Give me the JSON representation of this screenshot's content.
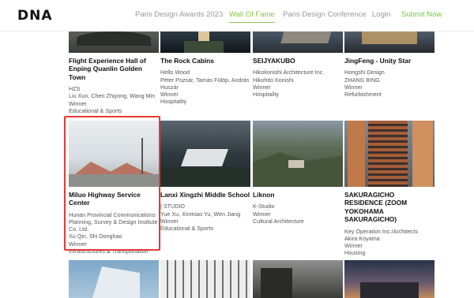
{
  "logo": "DNA",
  "nav": {
    "awards": "Paris Design Awards 2023",
    "wall": "Wall Of Fame",
    "conference": "Paris Design Conference",
    "login": "Login",
    "submit": "Submit Now"
  },
  "entries": [
    {
      "title": "Flight Experience Hall of Enping Quanlin Golden Town",
      "designer": [
        "HZS",
        "Liu Xun, Chen Zhiyong, Wang Min"
      ],
      "award": "Winner",
      "category": "Educational & Sports"
    },
    {
      "title": "The Rock Cabins",
      "designer": [
        "Hello Wood",
        "Péter Pozsár, Tamás Fülöp, András Huszár"
      ],
      "award": "Winner",
      "category": "Hospitality"
    },
    {
      "title": "SEIJYAKUBO",
      "designer": [
        "Hikokonishi Architecture Inc.",
        "Hikohito Konishi"
      ],
      "award": "Winner",
      "category": "Hospitality"
    },
    {
      "title": "JingFeng - Unity Star",
      "designer": [
        "Hongshi Design",
        "ZHANG BING"
      ],
      "award": "Winner",
      "category": "Refurbishment"
    },
    {
      "title": "Miluo Highway Service Center",
      "designer": [
        "Hunan Provincial Communications Planning, Survey & Design Institute Co. Ltd.",
        "Xu Qin, Shi Donghao"
      ],
      "award": "Winner",
      "category": "Infrastructures & Transportation"
    },
    {
      "title": "Lanxi Xingzhi Middle School",
      "designer": [
        "| STUDIO",
        "Yue Xu, Xinmiao Yu, Wen Jiang"
      ],
      "award": "Winner",
      "category": "Educational & Sports"
    },
    {
      "title": "Liknon",
      "designer": [
        "K-Studio"
      ],
      "award": "Winner",
      "category": "Cultural Architecture"
    },
    {
      "title": "SAKURAGICHO RESIDENCE (ZOOM YOKOHAMA SAKURAGICHO)",
      "designer": [
        "Key Operation Inc./Architects",
        "Akira Koyama"
      ],
      "award": "Winner",
      "category": "Housing"
    }
  ]
}
